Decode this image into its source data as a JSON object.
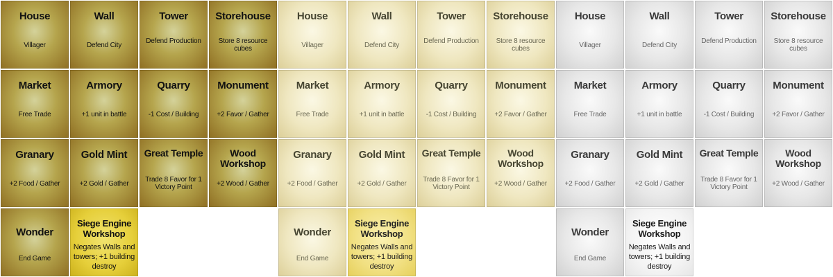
{
  "panels": [
    {
      "theme": "dark",
      "tiles": {
        "house": {
          "name": "House",
          "desc": "Villager"
        },
        "wall": {
          "name": "Wall",
          "desc": "Defend City"
        },
        "tower": {
          "name": "Tower",
          "desc": "Defend Production"
        },
        "storehouse": {
          "name": "Storehouse",
          "desc": "Store 8 resource cubes"
        },
        "market": {
          "name": "Market",
          "desc": "Free Trade"
        },
        "armory": {
          "name": "Armory",
          "desc": "+1 unit in battle"
        },
        "quarry": {
          "name": "Quarry",
          "desc": "-1 Cost / Building"
        },
        "monument": {
          "name": "Monument",
          "desc": "+2 Favor / Gather"
        },
        "granary": {
          "name": "Granary",
          "desc": "+2 Food / Gather"
        },
        "gold_mint": {
          "name": "Gold Mint",
          "desc": "+2 Gold / Gather"
        },
        "great_temple": {
          "name": "Great Temple",
          "desc": "Trade 8 Favor for 1 Victory Point"
        },
        "wood_workshop": {
          "name": "Wood Workshop",
          "desc": "+2 Wood / Gather"
        },
        "wonder": {
          "name": "Wonder",
          "desc": "End Game"
        },
        "siege_engine_workshop": {
          "name": "Siege Engine Workshop",
          "desc": "Negates Walls and towers; +1 building destroy"
        }
      }
    },
    {
      "theme": "light",
      "tiles": {
        "house": {
          "name": "House",
          "desc": "Villager"
        },
        "wall": {
          "name": "Wall",
          "desc": "Defend City"
        },
        "tower": {
          "name": "Tower",
          "desc": "Defend Production"
        },
        "storehouse": {
          "name": "Storehouse",
          "desc": "Store 8 resource cubes"
        },
        "market": {
          "name": "Market",
          "desc": "Free Trade"
        },
        "armory": {
          "name": "Armory",
          "desc": "+1 unit in battle"
        },
        "quarry": {
          "name": "Quarry",
          "desc": "-1 Cost / Building"
        },
        "monument": {
          "name": "Monument",
          "desc": "+2 Favor / Gather"
        },
        "granary": {
          "name": "Granary",
          "desc": "+2 Food / Gather"
        },
        "gold_mint": {
          "name": "Gold Mint",
          "desc": "+2 Gold / Gather"
        },
        "great_temple": {
          "name": "Great Temple",
          "desc": "Trade 8 Favor for 1 Victory Point"
        },
        "wood_workshop": {
          "name": "Wood Workshop",
          "desc": "+2 Wood / Gather"
        },
        "wonder": {
          "name": "Wonder",
          "desc": "End Game"
        },
        "siege_engine_workshop": {
          "name": "Siege Engine Workshop",
          "desc": "Negates Walls and towers; +1 building destroy"
        }
      }
    },
    {
      "theme": "gray",
      "tiles": {
        "house": {
          "name": "House",
          "desc": "Villager"
        },
        "wall": {
          "name": "Wall",
          "desc": "Defend City"
        },
        "tower": {
          "name": "Tower",
          "desc": "Defend Production"
        },
        "storehouse": {
          "name": "Storehouse",
          "desc": "Store 8 resource cubes"
        },
        "market": {
          "name": "Market",
          "desc": "Free Trade"
        },
        "armory": {
          "name": "Armory",
          "desc": "+1 unit in battle"
        },
        "quarry": {
          "name": "Quarry",
          "desc": "-1 Cost / Building"
        },
        "monument": {
          "name": "Monument",
          "desc": "+2 Favor / Gather"
        },
        "granary": {
          "name": "Granary",
          "desc": "+2 Food / Gather"
        },
        "gold_mint": {
          "name": "Gold Mint",
          "desc": "+2 Gold / Gather"
        },
        "great_temple": {
          "name": "Great Temple",
          "desc": "Trade 8 Favor for 1 Victory Point"
        },
        "wood_workshop": {
          "name": "Wood Workshop",
          "desc": "+2 Wood / Gather"
        },
        "wonder": {
          "name": "Wonder",
          "desc": "End Game"
        },
        "siege_engine_workshop": {
          "name": "Siege Engine Workshop",
          "desc": "Negates Walls and towers; +1 building destroy"
        }
      }
    }
  ]
}
